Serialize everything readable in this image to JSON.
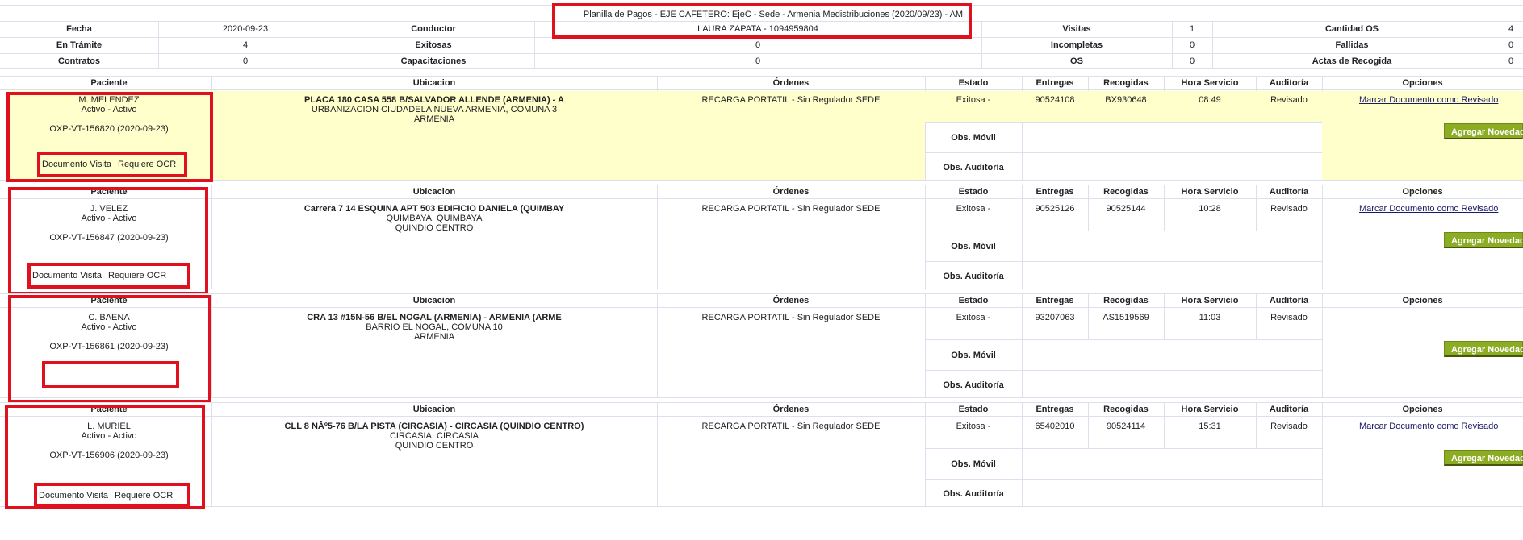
{
  "summary": {
    "title": "Planilla de Pagos - EJE CAFETERO: EjeC - Sede - Armenia Medistribuciones (2020/09/23) - AM",
    "row1": {
      "fecha_label": "Fecha",
      "fecha_value": "2020-09-23",
      "conductor_label": "Conductor",
      "conductor_value": "LAURA ZAPATA - 1094959804",
      "visitas_label": "Visitas",
      "visitas_value": "1",
      "cantidad_os_label": "Cantidad OS",
      "cantidad_os_value": "4"
    },
    "row2": {
      "en_tramite_label": "En Trámite",
      "en_tramite_value": "4",
      "exitosas_label": "Exitosas",
      "exitosas_value": "0",
      "incompletas_label": "Incompletas",
      "incompletas_value": "0",
      "fallidas_label": "Fallidas",
      "fallidas_value": "0"
    },
    "row3": {
      "contratos_label": "Contratos",
      "contratos_value": "0",
      "capacitaciones_label": "Capacitaciones",
      "capacitaciones_value": "0",
      "os_label": "OS",
      "os_value": "0",
      "actas_label": "Actas de Recogida",
      "actas_value": "0"
    }
  },
  "headers": {
    "paciente": "Paciente",
    "ubicacion": "Ubicacion",
    "ordenes": "Órdenes",
    "estado": "Estado",
    "entregas": "Entregas",
    "recogidas": "Recogidas",
    "hora": "Hora Servicio",
    "auditoria": "Auditoría",
    "opciones": "Opciones"
  },
  "labels": {
    "obs_movil": "Obs. Móvil",
    "obs_auditoria": "Obs. Auditoría",
    "documento_visita": "Documento Visita",
    "requiere_ocr": "Requiere OCR",
    "marcar": "Marcar Documento como Revisado",
    "agregar": "Agregar Novedad"
  },
  "records": [
    {
      "name": "M. MELENDEZ",
      "status": "Activo - Activo",
      "id": "OXP-VT-156820 (2020-09-23)",
      "loc1": "PLACA 180 CASA 558 B/SALVADOR ALLENDE (ARMENIA) - A",
      "loc2": "URBANIZACION CIUDADELA NUEVA ARMENIA, COMUNA 3",
      "loc3": "ARMENIA",
      "orden": "RECARGA PORTATIL - Sin Regulador SEDE",
      "estado": "Exitosa -",
      "entregas": "90524108",
      "recogidas": "BX930648",
      "hora": "08:49",
      "auditoria": "Revisado"
    },
    {
      "name": "J. VELEZ",
      "status": "Activo - Activo",
      "id": "OXP-VT-156847 (2020-09-23)",
      "loc1": "Carrera 7 14 ESQUINA APT 503 EDIFICIO DANIELA (QUIMBAY",
      "loc2": "QUIMBAYA, QUIMBAYA",
      "loc3": "QUINDIO CENTRO",
      "orden": "RECARGA PORTATIL - Sin Regulador SEDE",
      "estado": "Exitosa -",
      "entregas": "90525126",
      "recogidas": "90525144",
      "hora": "10:28",
      "auditoria": "Revisado"
    },
    {
      "name": "C. BAENA",
      "status": "Activo - Activo",
      "id": "OXP-VT-156861 (2020-09-23)",
      "loc1": "CRA 13 #15N-56 B/EL NOGAL (ARMENIA) - ARMENIA (ARME",
      "loc2": "BARRIO EL NOGAL, COMUNA 10",
      "loc3": "ARMENIA",
      "orden": "RECARGA PORTATIL - Sin Regulador SEDE",
      "estado": "Exitosa -",
      "entregas": "93207063",
      "recogidas": "AS1519569",
      "hora": "11:03",
      "auditoria": "Revisado"
    },
    {
      "name": "L. MURIEL",
      "status": "Activo - Activo",
      "id": "OXP-VT-156906 (2020-09-23)",
      "loc1": "CLL 8 NÂº5-76 B/LA PISTA (CIRCASIA) - CIRCASIA (QUINDIO CENTRO)",
      "loc2": "CIRCASIA, CIRCASIA",
      "loc3": "QUINDIO CENTRO",
      "orden": "RECARGA PORTATIL - Sin Regulador SEDE",
      "estado": "Exitosa -",
      "entregas": "65402010",
      "recogidas": "90524114",
      "hora": "15:31",
      "auditoria": "Revisado"
    }
  ]
}
